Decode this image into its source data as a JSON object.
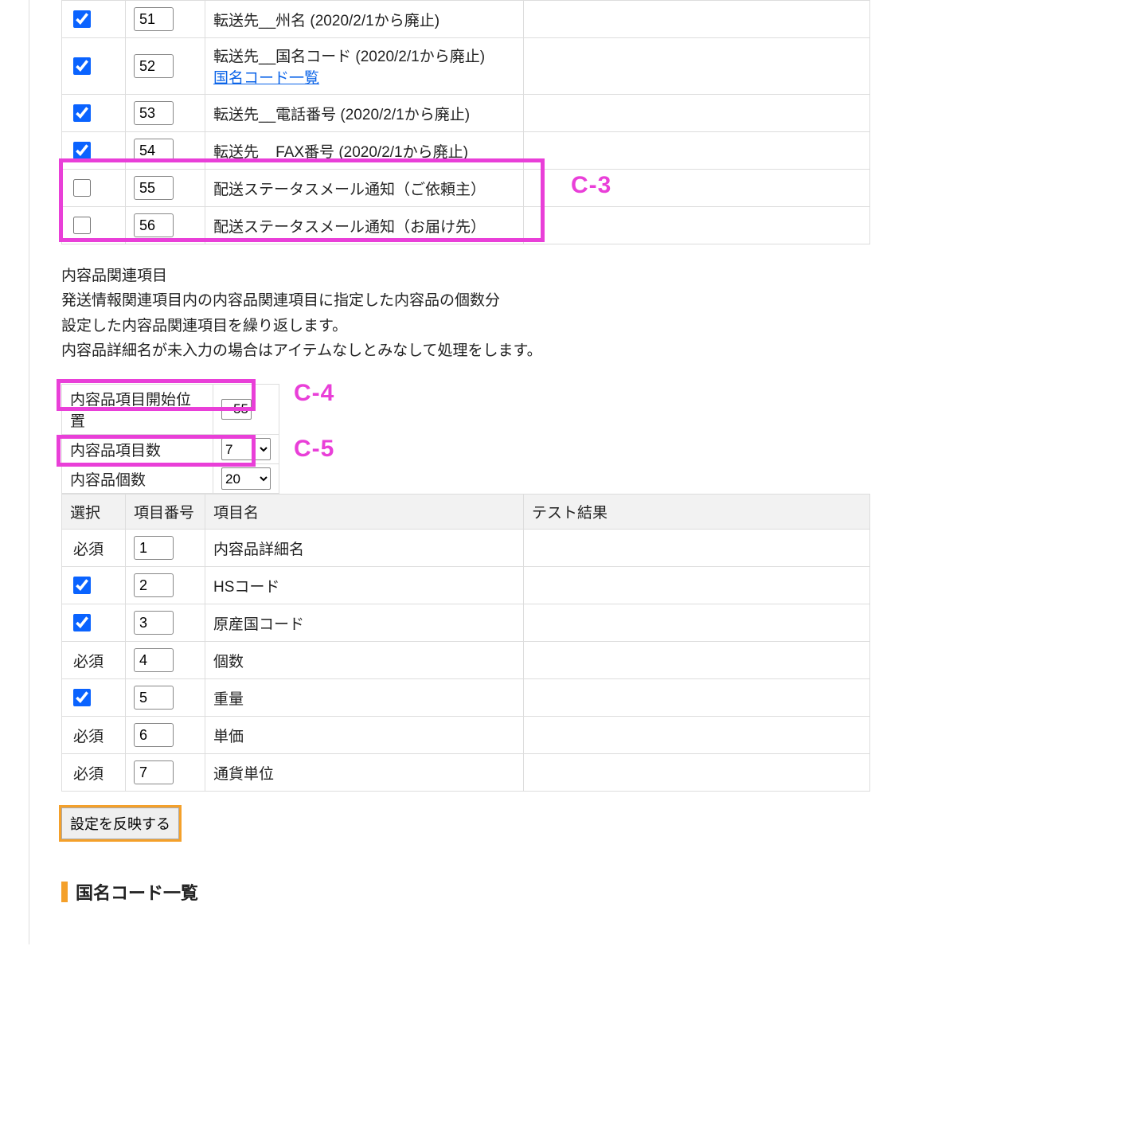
{
  "colors": {
    "highlight": "#e93fd8",
    "accent": "#f4a02a",
    "link": "#0a63e8",
    "checkbox": "#0a63ff"
  },
  "table1": {
    "rows": [
      {
        "checked": true,
        "num": "51",
        "name": "転送先__州名 (2020/2/1から廃止)",
        "link": null
      },
      {
        "checked": true,
        "num": "52",
        "name": "転送先__国名コード (2020/2/1から廃止)",
        "link": "国名コード一覧"
      },
      {
        "checked": true,
        "num": "53",
        "name": "転送先__電話番号 (2020/2/1から廃止)",
        "link": null
      },
      {
        "checked": true,
        "num": "54",
        "name": "転送先__FAX番号 (2020/2/1から廃止)",
        "link": null
      },
      {
        "checked": false,
        "num": "55",
        "name": "配送ステータスメール通知（ご依頼主）",
        "link": null
      },
      {
        "checked": false,
        "num": "56",
        "name": "配送ステータスメール通知（お届け先）",
        "link": null
      }
    ]
  },
  "paragraph": {
    "line1": "内容品関連項目",
    "line2": "発送情報関連項目内の内容品関連項目に指定した内容品の個数分",
    "line3": "設定した内容品関連項目を繰り返します。",
    "line4": "内容品詳細名が未入力の場合はアイテムなしとみなして処理をします。"
  },
  "kv": {
    "start_label": "内容品項目開始位置",
    "start_value": "55",
    "count_label": "内容品項目数",
    "count_value": "7",
    "qty_label": "内容品個数",
    "qty_value": "20"
  },
  "table2": {
    "headers": {
      "select": "選択",
      "num": "項目番号",
      "name": "項目名",
      "test": "テスト結果"
    },
    "must_label": "必須",
    "rows": [
      {
        "select": "must",
        "num": "1",
        "name": "内容品詳細名"
      },
      {
        "select": "checked",
        "num": "2",
        "name": "HSコード"
      },
      {
        "select": "checked",
        "num": "3",
        "name": "原産国コード"
      },
      {
        "select": "must",
        "num": "4",
        "name": "個数"
      },
      {
        "select": "checked",
        "num": "5",
        "name": "重量"
      },
      {
        "select": "must",
        "num": "6",
        "name": "単価"
      },
      {
        "select": "must",
        "num": "7",
        "name": "通貨単位"
      }
    ]
  },
  "button": {
    "reflect_label": "設定を反映する"
  },
  "section": {
    "title": "国名コード一覧"
  },
  "callouts": {
    "c3": "C-3",
    "c4": "C-4",
    "c5": "C-5"
  }
}
